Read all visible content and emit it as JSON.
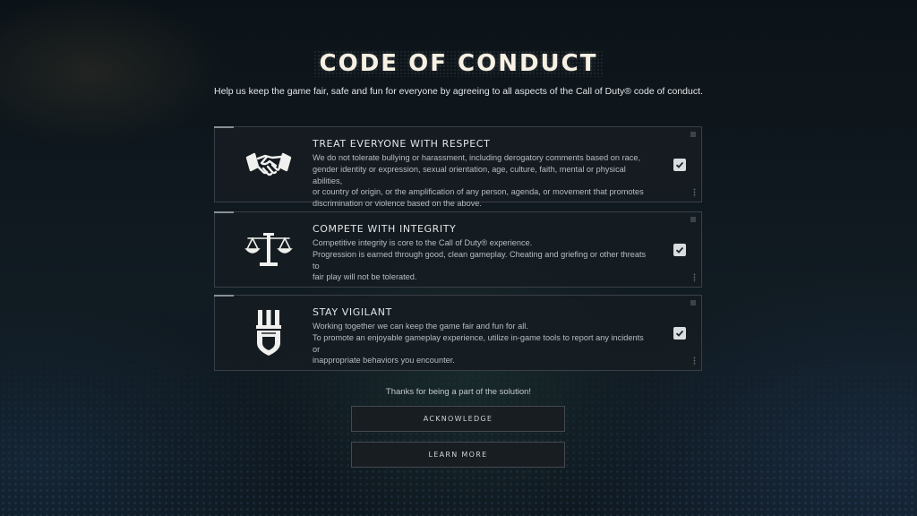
{
  "header": {
    "title": "CODE OF CONDUCT",
    "subtitle": "Help us keep the game fair, safe and fun for everyone by agreeing to all aspects of the Call of Duty® code of conduct."
  },
  "rules": [
    {
      "icon": "handshake-icon",
      "heading": "TREAT EVERYONE WITH RESPECT",
      "body": "We do not tolerate bullying or harassment, including derogatory comments based on race,\ngender identity or expression, sexual orientation, age, culture, faith, mental or physical abilities,\nor country of origin, or the amplification of any person, agenda, or movement that promotes\ndiscrimination or violence based on the above.",
      "checked": true
    },
    {
      "icon": "scales-icon",
      "heading": "COMPETE WITH INTEGRITY",
      "body": "Competitive integrity is core to the Call of Duty® experience.\nProgression is earned through good, clean gameplay. Cheating and griefing or other threats to\nfair play will not be tolerated.",
      "checked": true
    },
    {
      "icon": "shield-badge-icon",
      "heading": "STAY VIGILANT",
      "body": "Working together we can keep the game fair and fun for all.\nTo promote an enjoyable gameplay experience, utilize in-game tools to report any incidents or\ninappropriate behaviors you encounter.",
      "checked": true
    }
  ],
  "footer": {
    "thanks": "Thanks for being a part of the solution!",
    "acknowledge_label": "ACKNOWLEDGE",
    "learn_more_label": "LEARN MORE"
  },
  "colors": {
    "background": "#0e151b",
    "card": "#161c22",
    "title": "#f6f1e3",
    "checkbox": "#d9dde0"
  }
}
